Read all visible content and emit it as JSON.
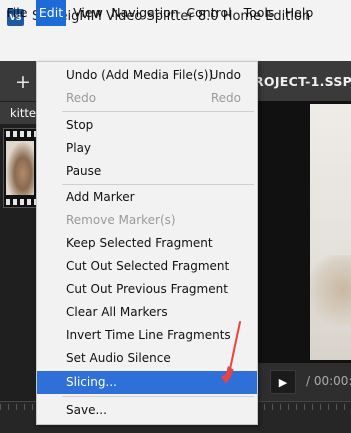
{
  "window": {
    "title": "SolveigMM Video Splitter 8.0 Home Edition",
    "icon_text": "VS"
  },
  "menubar": [
    "File",
    "Edit",
    "View",
    "Navigation",
    "Control",
    "Tools",
    "Help"
  ],
  "toolbar": {
    "add_symbol": "+",
    "project_title": "ROJECT-1.SSP"
  },
  "left_panel": {
    "file_tab_label": "kitter"
  },
  "player": {
    "play_symbol": "▶",
    "time_text": "/ 00:00:"
  },
  "edit_menu": {
    "items": [
      {
        "label": "Undo (Add Media File(s))",
        "shortcut": "Undo",
        "enabled": true
      },
      {
        "label": "Redo",
        "shortcut": "Redo",
        "enabled": false
      },
      {
        "label": "Stop",
        "enabled": true
      },
      {
        "label": "Play",
        "enabled": true
      },
      {
        "label": "Pause",
        "enabled": true
      },
      {
        "label": "Add Marker",
        "enabled": true
      },
      {
        "label": "Remove Marker(s)",
        "enabled": false
      },
      {
        "label": "Keep Selected Fragment",
        "enabled": true
      },
      {
        "label": "Cut Out Selected Fragment",
        "enabled": true
      },
      {
        "label": "Cut Out Previous Fragment",
        "enabled": true
      },
      {
        "label": "Clear All Markers",
        "enabled": true
      },
      {
        "label": "Invert Time Line Fragments",
        "enabled": true
      },
      {
        "label": "Set Audio Silence",
        "enabled": true
      },
      {
        "label": "Slicing...",
        "enabled": true,
        "highlighted": true
      },
      {
        "label": "Save...",
        "enabled": true
      }
    ]
  },
  "colors": {
    "menu_highlight": "#2e6fd8",
    "annotation_arrow": "#e8453c"
  }
}
